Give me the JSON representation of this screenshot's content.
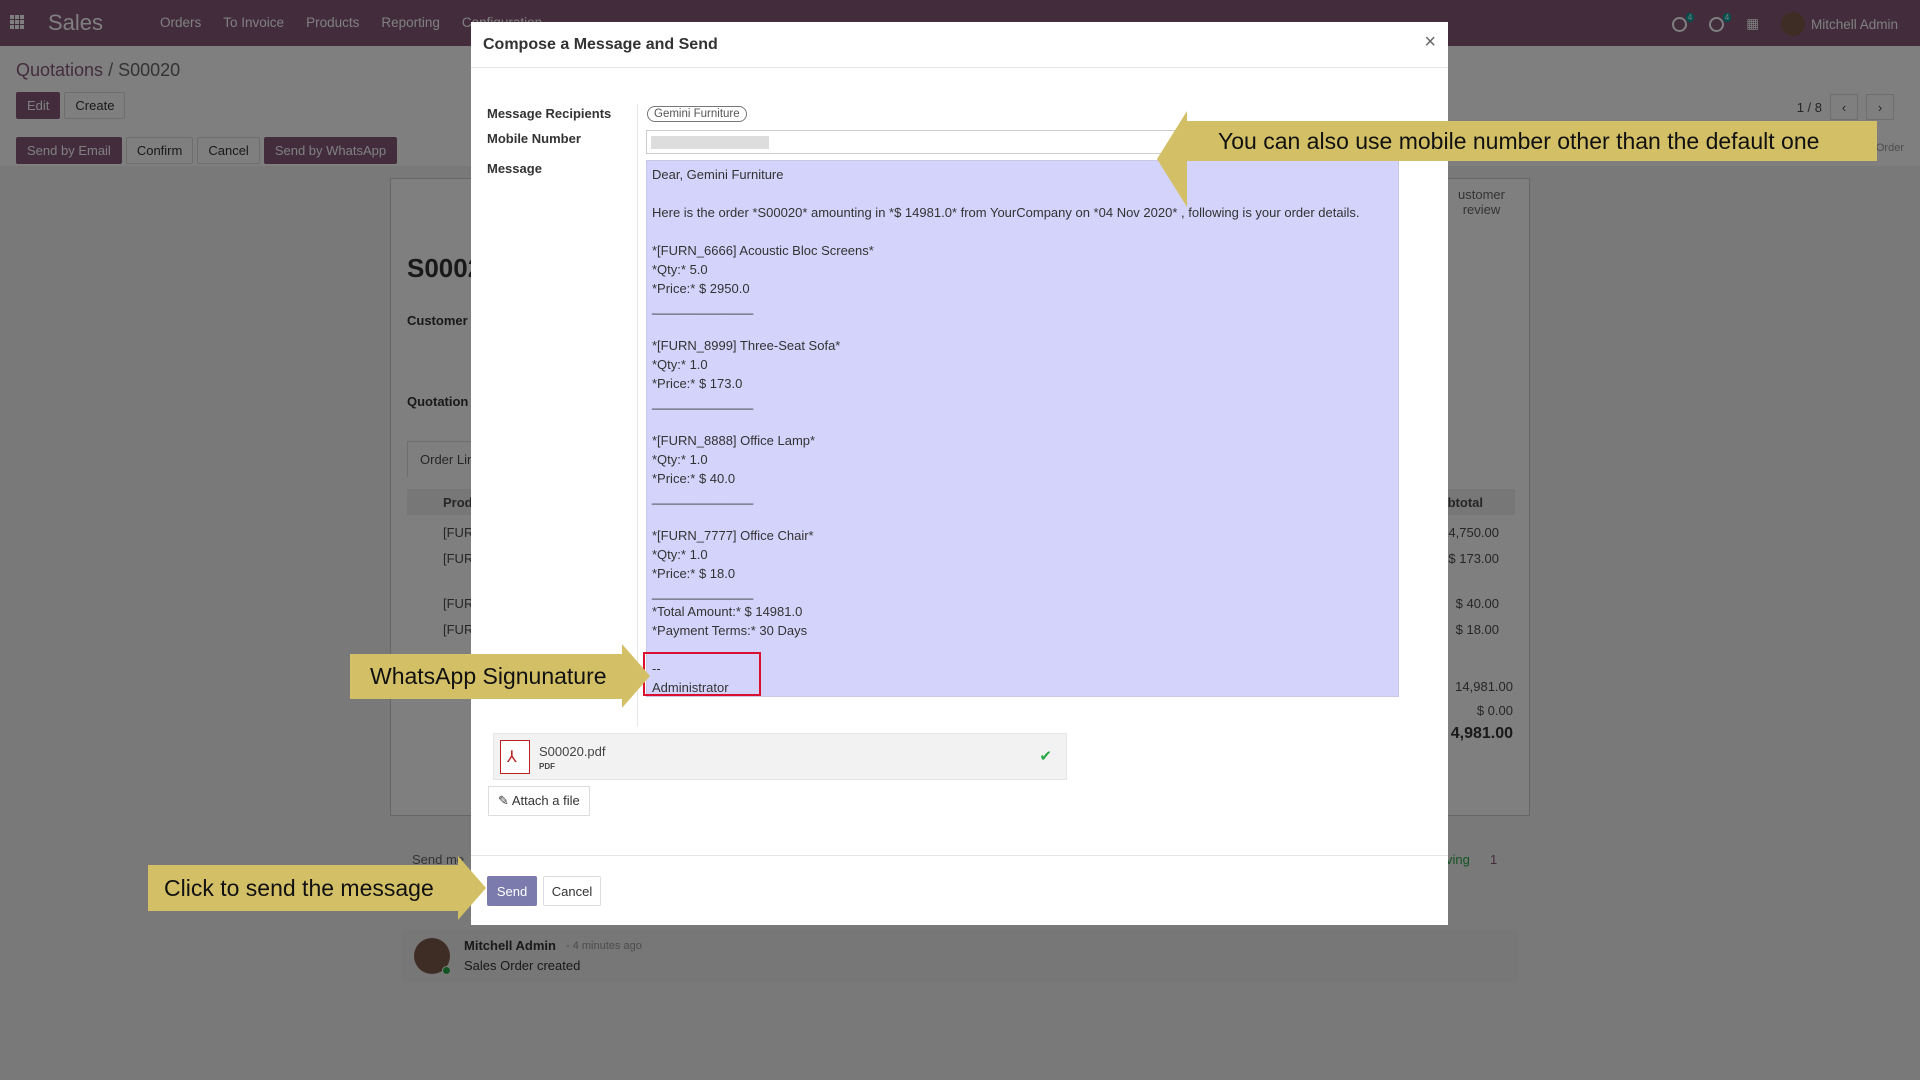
{
  "navbar": {
    "brand": "Sales",
    "menu": [
      "Orders",
      "To Invoice",
      "Products",
      "Reporting",
      "Configuration"
    ],
    "activity_count": "4",
    "message_count": "4",
    "user_name": "Mitchell Admin"
  },
  "control_panel": {
    "breadcrumb_parent": "Quotations",
    "breadcrumb_sep": "/",
    "breadcrumb_current": "S00020",
    "edit_label": "Edit",
    "create_label": "Create",
    "send_email_label": "Send by Email",
    "confirm_label": "Confirm",
    "cancel_label": "Cancel",
    "whatsapp_label": "Send by WhatsApp",
    "pager": "1 / 8",
    "status_order": "Order"
  },
  "sheet": {
    "title": "S0002",
    "customer_label": "Customer",
    "quotation_label": "Quotation",
    "tab_order_lines": "Order Lin",
    "col_product": "Prod",
    "col_subtotal": "btotal",
    "portal_label": "ustomer\nreview",
    "rows": [
      {
        "product": "[FUR",
        "subtotal": "14,750.00"
      },
      {
        "product": "[FUR",
        "subtotal": "$ 173.00"
      },
      {
        "product": "[FUR",
        "subtotal": "$ 40.00"
      },
      {
        "product": "[FUR",
        "subtotal": "$ 18.00"
      }
    ],
    "untaxed": "14,981.00",
    "taxes": "$ 0.00",
    "total": "4,981.00"
  },
  "chatter": {
    "send_message": "Send me",
    "following": "ving",
    "followers": "1",
    "author": "Mitchell Admin",
    "time": "- 4 minutes ago",
    "body": "Sales Order created"
  },
  "modal": {
    "title": "Compose a Message and Send",
    "close": "×",
    "recipients_label": "Message Recipients",
    "recipient": "Gemini Furniture",
    "mobile_label": "Mobile Number",
    "message_label": "Message",
    "message_text": "Dear, Gemini Furniture\n\nHere is the order *S00020* amounting in *$ 14981.0* from YourCompany on *04 Nov 2020* , following is your order details.\n\n*[FURN_6666] Acoustic Bloc Screens*\n*Qty:* 5.0\n*Price:* $ 2950.0\n______________\n\n*[FURN_8999] Three-Seat Sofa*\n*Qty:* 1.0\n*Price:* $ 173.0\n______________\n\n*[FURN_8888] Office Lamp*\n*Qty:* 1.0\n*Price:* $ 40.0\n______________\n\n*[FURN_7777] Office Chair*\n*Qty:* 1.0\n*Price:* $ 18.0\n______________\n*Total Amount:* $ 14981.0\n*Payment Terms:* 30 Days\n\n--\nAdministrator",
    "attachment_name": "S00020.pdf",
    "attachment_type": "PDF",
    "attach_button": "Attach a file",
    "send_button": "Send",
    "cancel_button": "Cancel"
  },
  "callouts": {
    "mobile": "You can also use mobile number other than the default one",
    "signature": "WhatsApp Signunature",
    "send": "Click to send the message"
  },
  "colors": {
    "primary": "#875a7b",
    "callout": "#d3c066",
    "message_highlight": "#d4d3fb",
    "signature_border": "#d9102f"
  }
}
